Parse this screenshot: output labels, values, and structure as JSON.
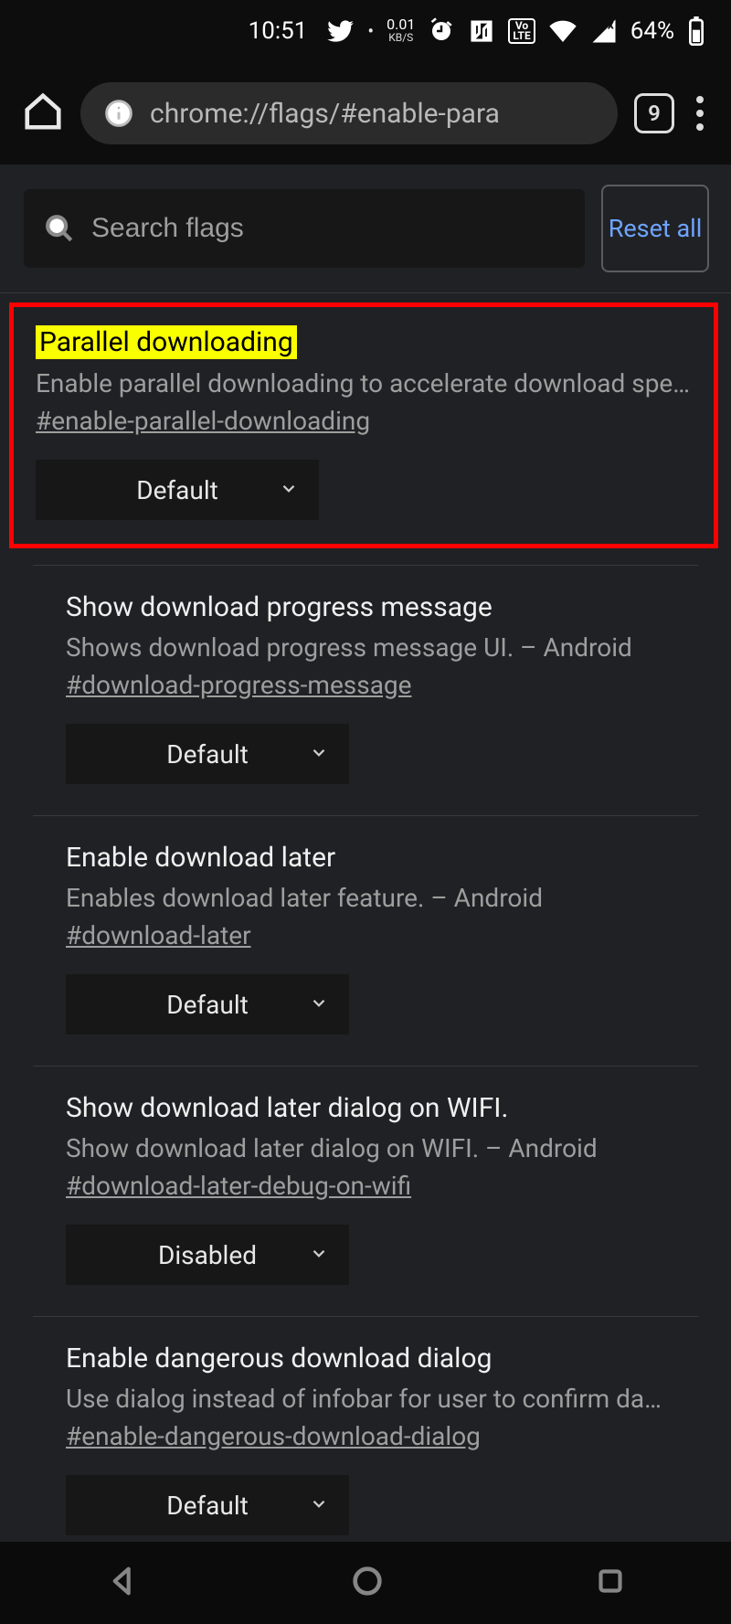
{
  "status": {
    "time": "10:51",
    "kbs_num": "0.01",
    "kbs_label": "KB/S",
    "battery": "64%"
  },
  "browser": {
    "url": "chrome://flags/#enable-para",
    "tab_count": "9"
  },
  "search": {
    "placeholder": "Search flags",
    "reset_label": "Reset all"
  },
  "flags": [
    {
      "title": "Parallel downloading",
      "desc": "Enable parallel downloading to accelerate download spe...",
      "hash": "#enable-parallel-downloading",
      "value": "Default",
      "highlighted": true
    },
    {
      "title": "Show download progress message",
      "desc": "Shows download progress message UI. – Android",
      "hash": "#download-progress-message",
      "value": "Default"
    },
    {
      "title": "Enable download later",
      "desc": "Enables download later feature. – Android",
      "hash": "#download-later",
      "value": "Default"
    },
    {
      "title": "Show download later dialog on WIFI.",
      "desc": "Show download later dialog on WIFI. – Android",
      "hash": "#download-later-debug-on-wifi",
      "value": "Disabled"
    },
    {
      "title": "Enable dangerous download dialog",
      "desc": "Use dialog instead of infobar for user to confirm dangero...",
      "hash": "#enable-dangerous-download-dialog",
      "value": "Default"
    }
  ]
}
